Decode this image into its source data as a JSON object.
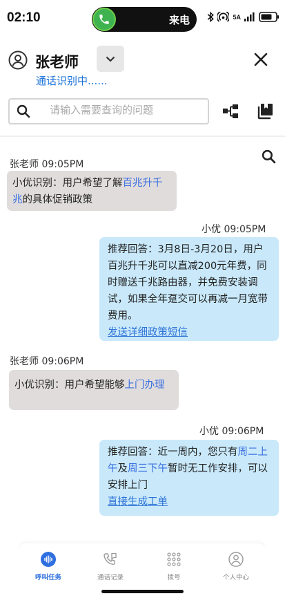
{
  "status_bar": {
    "time": "02:10",
    "call_label": "来电",
    "network": "5A"
  },
  "header": {
    "caller_name": "张老师",
    "recognition_status": "通话识别中......"
  },
  "search": {
    "placeholder": "请输入需要查询的问题"
  },
  "messages": [
    {
      "sender": "张老师 09:05PM",
      "prefix": "小优识别：用户希望了解",
      "highlight": "百兆升千兆",
      "suffix": "的具体促销政策"
    },
    {
      "sender": "小优 09:05PM",
      "text": "推荐回答：3月8日-3月20日，用户百兆升千兆可以直减200元年费，同时赠送千兆路由器，并免费安装调试，如果全年趸交可以再减一月宽带费用。",
      "link": "发送详细政策短信"
    },
    {
      "sender": "张老师 09:06PM",
      "prefix": "小优识别：用户希望能够",
      "highlight": "上门办理"
    },
    {
      "sender": "小优 09:06PM",
      "t1": "推荐回答：近一周内，您只有",
      "h1": "周二上午",
      "t2": "及",
      "h2": "周三下午",
      "t3": "暂时无工作安排，可以安排上门",
      "link": "直接生成工单"
    }
  ],
  "bottom_nav": [
    {
      "label": "呼叫任务",
      "icon": "voice-wave-icon",
      "active": true
    },
    {
      "label": "通话记录",
      "icon": "phone-log-icon",
      "active": false
    },
    {
      "label": "拨号",
      "icon": "dialpad-icon",
      "active": false
    },
    {
      "label": "个人中心",
      "icon": "user-icon",
      "active": false
    }
  ],
  "colors": {
    "accent": "#2f6fe0",
    "agent_bubble": "#c9e9fb",
    "user_bubble": "#e0dcdc",
    "call_green": "#3fb34f"
  }
}
